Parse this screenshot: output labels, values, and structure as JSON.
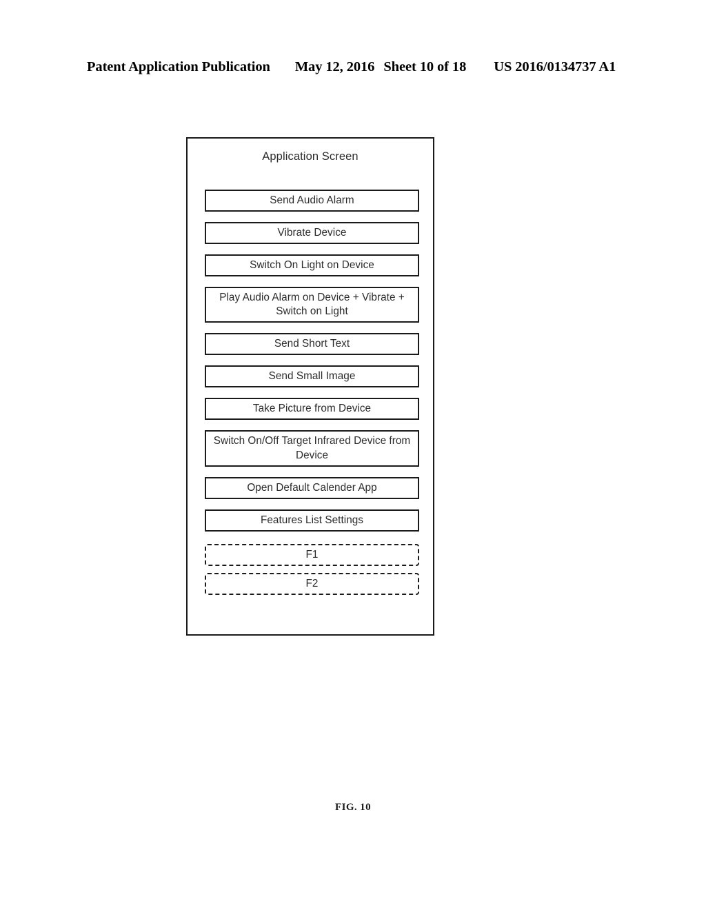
{
  "header": {
    "publication": "Patent Application Publication",
    "date": "May 12, 2016",
    "sheet": "Sheet 10 of 18",
    "document_number": "US 2016/0134737 A1"
  },
  "figure": {
    "caption": "FIG. 10",
    "screen_title": "Application Screen",
    "buttons": [
      {
        "label": "Send Audio Alarm",
        "style": "solid"
      },
      {
        "label": "Vibrate Device",
        "style": "solid"
      },
      {
        "label": "Switch On Light on Device",
        "style": "solid"
      },
      {
        "label": "Play Audio Alarm on Device + Vibrate + Switch on Light",
        "style": "solid-two-line"
      },
      {
        "label": "Send Short Text",
        "style": "solid"
      },
      {
        "label": "Send Small Image",
        "style": "solid"
      },
      {
        "label": "Take Picture from Device",
        "style": "solid"
      },
      {
        "label": "Switch On/Off Target Infrared Device from Device",
        "style": "solid-two-line"
      },
      {
        "label": "Open Default Calender App",
        "style": "solid"
      },
      {
        "label": "Features List Settings",
        "style": "solid"
      },
      {
        "label": "F1",
        "style": "dashed"
      },
      {
        "label": "F2",
        "style": "dashed"
      }
    ]
  },
  "colors": {
    "stroke": "#1a1a1a",
    "text": "#2b2b2b",
    "background": "#ffffff"
  }
}
